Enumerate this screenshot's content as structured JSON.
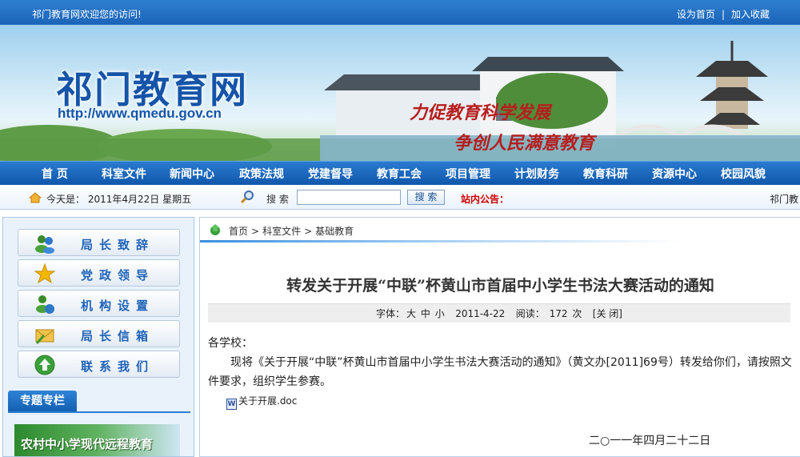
{
  "topbar": {
    "welcome": "祁门教育网欢迎您的访问!",
    "set_home": "设为首页",
    "separator": "|",
    "bookmark": "加入收藏"
  },
  "banner": {
    "site_name": "祁门教育网",
    "site_url": "http://www.qmedu.gov.cn",
    "slogan_line1": "力促教育科学发展",
    "slogan_line2": "争创人民满意教育"
  },
  "nav": {
    "items": [
      "首 页",
      "科室文件",
      "新闻中心",
      "政策法规",
      "党建督导",
      "教育工会",
      "项目管理",
      "计划财务",
      "教育科研",
      "资源中心",
      "校园风貌"
    ]
  },
  "info": {
    "today": "今天是： 2011年4月22日 星期五",
    "search_label": "搜 索",
    "search_value": "",
    "search_button": "搜 索",
    "notice_label": "站内公告：",
    "marquee": "祁门教"
  },
  "sidebar": {
    "buttons": [
      "局长致辞",
      "党政领导",
      "机构设置",
      "局长信箱",
      "联系我们"
    ],
    "special_tab": "专题专栏",
    "promo_text": "农村中小学现代远程教育"
  },
  "breadcrumb": {
    "home": "首页",
    "arrow": ">",
    "level1": "科室文件",
    "level2": "基础教育"
  },
  "article": {
    "title": "转发关于开展“中联”杯黄山市首届中小学生书法大赛活动的通知",
    "meta": {
      "font_label": "字体：",
      "size_large": "大",
      "size_medium": "中",
      "size_small": "小",
      "date": "2011-4-22",
      "read_label": "阅读：",
      "read_count": "172",
      "read_unit": "次",
      "close": "[关 闭]"
    },
    "salutation": "各学校：",
    "paragraph": "现将《关于开展“中联”杯黄山市首届中小学生书法大赛活动的通知》（黄文办[2011]69号）转发给你们，请按照文件要求，组织学生参赛。",
    "attachment": "关于开展.doc",
    "sign_date": "二○一一年四月二十二日"
  },
  "colors": {
    "brand_blue": "#1a64b8",
    "notice_red": "#cc0000",
    "slogan_red": "#b81d1d"
  }
}
